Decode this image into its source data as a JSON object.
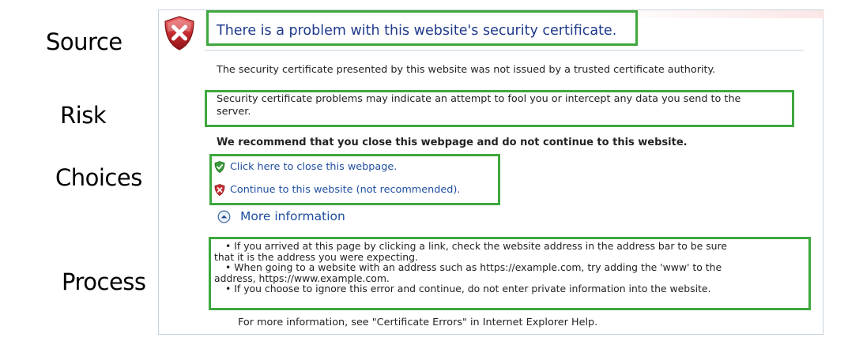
{
  "labels": {
    "source": "Source",
    "risk": "Risk",
    "choices": "Choices",
    "process": "Process"
  },
  "page": {
    "title": "There is a problem with this website's security certificate.",
    "not_trusted": "The security certificate presented by this website was not issued by a trusted certificate authority.",
    "risk_text_line1": "Security certificate problems may indicate an attempt to fool you or intercept any data you send to the",
    "risk_text_line2": "server.",
    "recommendation": "We recommend that you close this webpage and do not continue to this website.",
    "close_link": "Click here to close this webpage.",
    "continue_link": "Continue to this website (not recommended).",
    "more_info": "More information",
    "bullets": [
      "• If you arrived at this page by clicking a link, check the website address in the address bar to be sure",
      "that it is the address you were expecting.",
      "• When going to a website with an address such as https://example.com, try adding the 'www' to the",
      "address, https://www.example.com.",
      "• If you choose to ignore this error and continue, do not enter private information into the website."
    ],
    "footer": "For more information, see \"Certificate Errors\" in Internet Explorer Help."
  },
  "colors": {
    "highlight": "#3ea83e",
    "link": "#1f4fa0",
    "title": "#1f3a8c",
    "shield_red": "#c0282c"
  },
  "icons": {
    "shield": "red-shield-x-icon",
    "close": "green-shield-check-icon",
    "continue": "red-shield-x-small-icon",
    "more": "circle-chevron-up-icon"
  }
}
